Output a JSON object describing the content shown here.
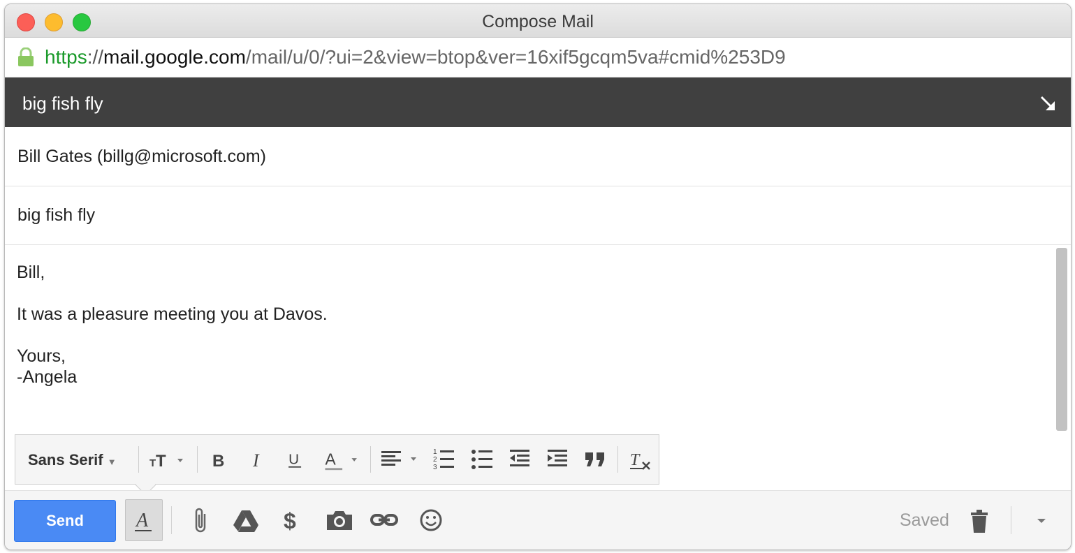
{
  "window": {
    "title": "Compose Mail"
  },
  "urlbar": {
    "scheme": "https",
    "separator": "://",
    "host": "mail.google.com",
    "path": "/mail/u/0/?ui=2&view=btop&ver=16xif5gcqm5va#cmid%253D9"
  },
  "compose": {
    "header_title": "big fish fly",
    "to_value": "Bill Gates (billg@microsoft.com)",
    "subject_value": "big fish fly",
    "body_lines": [
      "Bill,",
      "It was a pleasure meeting you at Davos.",
      "Yours,",
      "-Angela"
    ]
  },
  "format_toolbar": {
    "font_name": "Sans Serif",
    "icons": [
      "font-size-icon",
      "bold-icon",
      "italic-icon",
      "underline-icon",
      "text-color-icon",
      "align-icon",
      "numbered-list-icon",
      "bulleted-list-icon",
      "indent-less-icon",
      "indent-more-icon",
      "quote-icon",
      "remove-formatting-icon"
    ]
  },
  "bottom_bar": {
    "send_label": "Send",
    "saved_label": "Saved",
    "icons": [
      "formatting-options-icon",
      "attach-icon",
      "drive-icon",
      "money-icon",
      "photo-icon",
      "link-icon",
      "emoji-icon",
      "trash-icon",
      "more-options-icon"
    ]
  },
  "colors": {
    "header_bg": "#404040",
    "send_button": "#4a8af4",
    "url_scheme": "#1a9a2a",
    "close": "#fc5f57",
    "minimize": "#fdbc2e",
    "maximize": "#28c840"
  }
}
